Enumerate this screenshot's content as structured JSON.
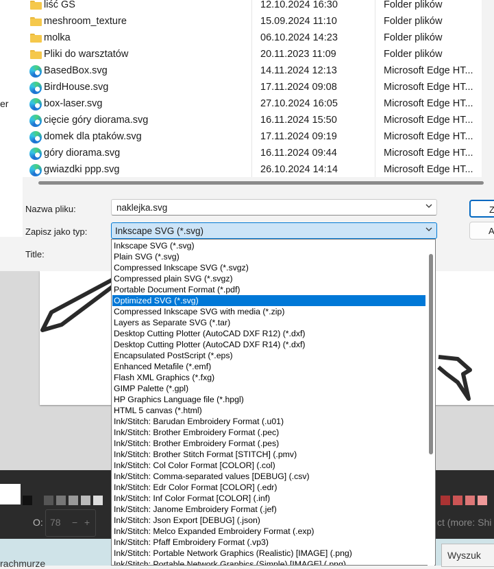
{
  "files": [
    {
      "name": "liść GS",
      "date": "12.10.2024 16:30",
      "type": "Folder plików",
      "icon": "folder-icon"
    },
    {
      "name": "meshroom_texture",
      "date": "15.09.2024 11:10",
      "type": "Folder plików",
      "icon": "folder-icon"
    },
    {
      "name": "molka",
      "date": "06.10.2024 14:23",
      "type": "Folder plików",
      "icon": "folder-icon"
    },
    {
      "name": "Pliki do warsztatów",
      "date": "20.11.2023 11:09",
      "type": "Folder plików",
      "icon": "folder-icon"
    },
    {
      "name": "BasedBox.svg",
      "date": "14.11.2024 12:13",
      "type": "Microsoft Edge HT...",
      "icon": "edge-icon"
    },
    {
      "name": "BirdHouse.svg",
      "date": "17.11.2024 09:08",
      "type": "Microsoft Edge HT...",
      "icon": "edge-icon"
    },
    {
      "name": "box-laser.svg",
      "date": "27.10.2024 16:05",
      "type": "Microsoft Edge HT...",
      "icon": "edge-icon"
    },
    {
      "name": "cięcie góry diorama.svg",
      "date": "16.11.2024 15:50",
      "type": "Microsoft Edge HT...",
      "icon": "edge-icon"
    },
    {
      "name": "domek dla ptaków.svg",
      "date": "17.11.2024 09:19",
      "type": "Microsoft Edge HT...",
      "icon": "edge-icon"
    },
    {
      "name": "góry diorama.svg",
      "date": "16.11.2024 09:44",
      "type": "Microsoft Edge HT...",
      "icon": "edge-icon"
    },
    {
      "name": "gwiazdki ppp.svg",
      "date": "26.10.2024 14:14",
      "type": "Microsoft Edge HT...",
      "icon": "edge-icon"
    }
  ],
  "left_pane_fragment": "er",
  "form": {
    "filename_label": "Nazwa pliku:",
    "filename_value": "naklejka.svg",
    "type_label": "Zapisz jako typ:",
    "type_value": "Inkscape SVG (*.svg)",
    "title_label": "Title:",
    "save_label": "Z",
    "cancel_label": "A"
  },
  "dropdown": {
    "selected": "Optimized SVG (*.svg)",
    "options": [
      "Inkscape SVG (*.svg)",
      "Plain SVG (*.svg)",
      "Compressed Inkscape SVG (*.svgz)",
      "Compressed plain SVG (*.svgz)",
      "Portable Document Format (*.pdf)",
      "Optimized SVG (*.svg)",
      "Compressed Inkscape SVG with media (*.zip)",
      "Layers as Separate SVG (*.tar)",
      "Desktop Cutting Plotter (AutoCAD DXF R12) (*.dxf)",
      "Desktop Cutting Plotter (AutoCAD DXF R14) (*.dxf)",
      "Encapsulated PostScript (*.eps)",
      "Enhanced Metafile (*.emf)",
      "Flash XML Graphics (*.fxg)",
      "GIMP Palette (*.gpl)",
      "HP Graphics Language file (*.hpgl)",
      "HTML 5 canvas (*.html)",
      "Ink/Stitch: Barudan Embroidery Format (.u01)",
      "Ink/Stitch: Brother Embroidery Format (.pec)",
      "Ink/Stitch: Brother Embroidery Format (.pes)",
      "Ink/Stitch: Brother Stitch Format [STITCH] (.pmv)",
      "Ink/Stitch: Col Color Format [COLOR] (.col)",
      "Ink/Stitch: Comma-separated values [DEBUG] (.csv)",
      "Ink/Stitch: Edr Color Format [COLOR] (.edr)",
      "Ink/Stitch: Inf Color Format [COLOR] (.inf)",
      "Ink/Stitch: Janome Embroidery Format (.jef)",
      "Ink/Stitch: Json Export [DEBUG] (.json)",
      "Ink/Stitch: Melco Expanded Embroidery Format (.exp)",
      "Ink/Stitch: Pfaff Embroidery Format (.vp3)",
      "Ink/Stitch: Portable Network Graphics (Realistic) [IMAGE] (.png)",
      "Ink/Stitch: Portable Network Graphics (Simple) [IMAGE] (.png)"
    ]
  },
  "background": {
    "opacity_label": "O:",
    "opacity_value": "78",
    "minus": "−",
    "plus": "+",
    "status_fragment": "ct (more: Shi",
    "search_fragment": "Wyszuk",
    "bottom_left_fragment": "rachmurze"
  },
  "colors": {
    "accent": "#0078d7",
    "folder": "#f5c84b",
    "selection_bg": "#cce4f7"
  }
}
